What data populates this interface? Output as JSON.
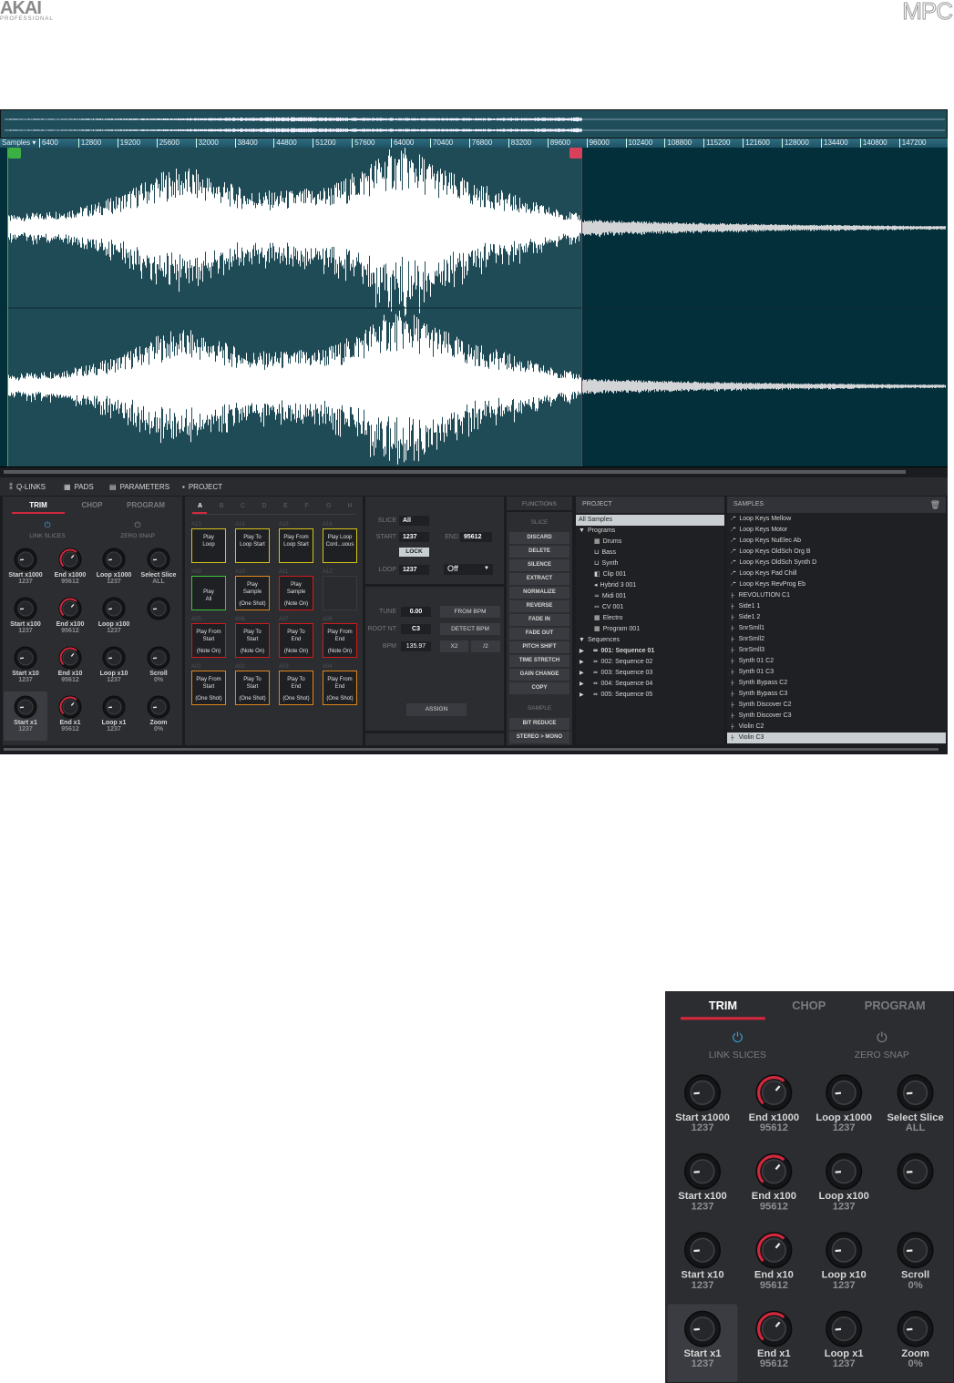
{
  "branding": {
    "akai": "AKAI",
    "akai_sub": "PROFESSIONAL",
    "mpc": "MPC"
  },
  "ruler": {
    "unit": "Samples",
    "ticks": [
      "6400",
      "12800",
      "19200",
      "25600",
      "32000",
      "38400",
      "44800",
      "51200",
      "57600",
      "64000",
      "70400",
      "76800",
      "83200",
      "89600",
      "96000",
      "102400",
      "108800",
      "115200",
      "121600",
      "128000",
      "134400",
      "140800",
      "147200"
    ]
  },
  "top_tabs": [
    {
      "label": "Q-LINKS",
      "icon": "q-links-icon"
    },
    {
      "label": "PADS",
      "icon": "pads-grid-icon"
    },
    {
      "label": "PARAMETERS",
      "icon": "parameters-icon"
    },
    {
      "label": "PROJECT",
      "icon": "project-file-icon"
    }
  ],
  "trim": {
    "tabs": [
      "TRIM",
      "CHOP",
      "PROGRAM"
    ],
    "active_tab": "TRIM",
    "toggles": [
      {
        "label": "LINK SLICES",
        "on": true
      },
      {
        "label": "ZERO SNAP",
        "on": false
      }
    ],
    "knobs": [
      {
        "label": "Start x1000",
        "value": "1237",
        "level": 0.02
      },
      {
        "label": "End x1000",
        "value": "95612",
        "level": 0.65
      },
      {
        "label": "Loop x1000",
        "value": "1237",
        "level": 0.02
      },
      {
        "label": "Select Slice",
        "value": "ALL",
        "level": 0.0
      },
      {
        "label": "Start x100",
        "value": "1237",
        "level": 0.02
      },
      {
        "label": "End x100",
        "value": "95612",
        "level": 0.65
      },
      {
        "label": "Loop x100",
        "value": "1237",
        "level": 0.02
      },
      {
        "label": "",
        "value": "",
        "level": 0.0
      },
      {
        "label": "Start x10",
        "value": "1237",
        "level": 0.02
      },
      {
        "label": "End x10",
        "value": "95612",
        "level": 0.65
      },
      {
        "label": "Loop x10",
        "value": "1237",
        "level": 0.02
      },
      {
        "label": "Scroll",
        "value": "0%",
        "level": 0.0
      },
      {
        "label": "Start x1",
        "value": "1237",
        "level": 0.02
      },
      {
        "label": "End x1",
        "value": "95612",
        "level": 0.65
      },
      {
        "label": "Loop x1",
        "value": "1237",
        "level": 0.02
      },
      {
        "label": "Zoom",
        "value": "0%",
        "level": 0.0
      }
    ]
  },
  "pads": {
    "banks": [
      "A",
      "B",
      "C",
      "D",
      "E",
      "F",
      "G",
      "H"
    ],
    "active_bank": "A",
    "grid": [
      {
        "id": "A13",
        "text": "Play\nLoop",
        "sub": "",
        "color": "#d6c419"
      },
      {
        "id": "A14",
        "text": "Play To\nLoop Start",
        "sub": "",
        "color": "#d6c419"
      },
      {
        "id": "A15",
        "text": "Play From\nLoop Start",
        "sub": "",
        "color": "#d6c419"
      },
      {
        "id": "A16",
        "text": "Play Loop\nCont...uous",
        "sub": "",
        "color": "#d6c419"
      },
      {
        "id": "A09",
        "text": "\nPlay\nAll",
        "sub": "",
        "color": "#3fc43f"
      },
      {
        "id": "A10",
        "text": "Play\nSample",
        "sub": "(One Shot)",
        "color": "#e0861a"
      },
      {
        "id": "A11",
        "text": "Play\nSample",
        "sub": "(Note On)",
        "color": "#d11a1a"
      },
      {
        "id": "A12",
        "text": "",
        "sub": "",
        "color": "#3a3a3c"
      },
      {
        "id": "A05",
        "text": "Play From\nStart",
        "sub": "(Note On)",
        "color": "#d11a1a"
      },
      {
        "id": "A06",
        "text": "Play To\nStart",
        "sub": "(Note On)",
        "color": "#d11a1a"
      },
      {
        "id": "A07",
        "text": "Play To\nEnd",
        "sub": "(Note On)",
        "color": "#d11a1a"
      },
      {
        "id": "A08",
        "text": "Play From\nEnd",
        "sub": "(Note On)",
        "color": "#d11a1a"
      },
      {
        "id": "A01",
        "text": "Play From\nStart",
        "sub": "(One Shot)",
        "color": "#e0861a"
      },
      {
        "id": "A02",
        "text": "Play To\nStart",
        "sub": "(One Shot)",
        "color": "#e0861a"
      },
      {
        "id": "A03",
        "text": "Play To\nEnd",
        "sub": "(One Shot)",
        "color": "#e0861a"
      },
      {
        "id": "A04",
        "text": "Play From\nEnd",
        "sub": "(One Shot)",
        "color": "#e0861a"
      }
    ]
  },
  "slice": {
    "slice_label": "SLICE",
    "slice_value": "All",
    "start_label": "START",
    "start_value": "1237",
    "end_label": "END",
    "end_value": "95612",
    "lock_label": "LOCK",
    "loop_label": "LOOP",
    "loop_value": "1237",
    "loop_mode": "Off",
    "tune_label": "TUNE",
    "tune_value": "0.00",
    "root_label": "ROOT NT",
    "root_value": "C3",
    "bpm_label": "BPM",
    "bpm_value": "135.97",
    "from_bpm": "FROM BPM",
    "detect_bpm": "DETECT BPM",
    "x2": "X2",
    "half": "/2",
    "assign": "ASSIGN"
  },
  "functions": {
    "title": "FUNCTIONS",
    "slice_header": "SLICE",
    "slice_items": [
      "DISCARD",
      "DELETE",
      "SILENCE",
      "EXTRACT",
      "NORMALIZE",
      "REVERSE",
      "FADE IN",
      "FADE OUT",
      "PITCH SHIFT",
      "TIME STRETCH",
      "GAIN CHANGE",
      "COPY"
    ],
    "sample_header": "SAMPLE",
    "sample_items": [
      "BIT REDUCE",
      "STEREO > MONO"
    ]
  },
  "project": {
    "title": "PROJECT",
    "items": [
      {
        "label": "All Samples",
        "indent": 0,
        "icon": "",
        "selected": true
      },
      {
        "label": "Programs",
        "indent": 0,
        "icon": "▼"
      },
      {
        "label": "Drums",
        "indent": 2,
        "icon": "▦"
      },
      {
        "label": "Bass",
        "indent": 2,
        "icon": "⊔"
      },
      {
        "label": "Synth",
        "indent": 2,
        "icon": "⊔"
      },
      {
        "label": "Clip 001",
        "indent": 2,
        "icon": "◧"
      },
      {
        "label": "Hybrid 3 001",
        "indent": 2,
        "icon": "◂"
      },
      {
        "label": "Midi 001",
        "indent": 2,
        "icon": "≂"
      },
      {
        "label": "CV 001",
        "indent": 2,
        "icon": "∾"
      },
      {
        "label": "Electro",
        "indent": 2,
        "icon": "▦"
      },
      {
        "label": "Program 001",
        "indent": 2,
        "icon": "▦"
      },
      {
        "label": "Sequences",
        "indent": 0,
        "icon": "▼"
      },
      {
        "label": "001: Sequence 01",
        "indent": 1,
        "icon": "≖",
        "bold": true
      },
      {
        "label": "002: Sequence 02",
        "indent": 1,
        "icon": "≖"
      },
      {
        "label": "003: Sequence 03",
        "indent": 1,
        "icon": "≖"
      },
      {
        "label": "004: Sequence 04",
        "indent": 1,
        "icon": "≖"
      },
      {
        "label": "005: Sequence 05",
        "indent": 1,
        "icon": "≖"
      }
    ]
  },
  "samples": {
    "title": "SAMPLES",
    "items": [
      {
        "label": "Loop Keys Mellow",
        "type": "loop"
      },
      {
        "label": "Loop Keys Motor",
        "type": "loop"
      },
      {
        "label": "Loop Keys NuElec Ab",
        "type": "loop"
      },
      {
        "label": "Loop Keys OldSch Org B",
        "type": "loop"
      },
      {
        "label": "Loop Keys OldSch Synth D",
        "type": "loop"
      },
      {
        "label": "Loop Keys Pad Chill",
        "type": "loop"
      },
      {
        "label": "Loop Keys RevProg Eb",
        "type": "loop"
      },
      {
        "label": "REVOLUTION C1",
        "type": "oneshot"
      },
      {
        "label": "Side1 1",
        "type": "oneshot"
      },
      {
        "label": "Side1 2",
        "type": "oneshot"
      },
      {
        "label": "SnrSmll1",
        "type": "oneshot"
      },
      {
        "label": "SnrSmll2",
        "type": "oneshot"
      },
      {
        "label": "SnrSmll3",
        "type": "oneshot"
      },
      {
        "label": "Synth 01 C2",
        "type": "oneshot"
      },
      {
        "label": "Synth 01 C3",
        "type": "oneshot"
      },
      {
        "label": "Synth Bypass C2",
        "type": "oneshot"
      },
      {
        "label": "Synth Bypass C3",
        "type": "oneshot"
      },
      {
        "label": "Synth Discover C2",
        "type": "oneshot"
      },
      {
        "label": "Synth Discover C3",
        "type": "oneshot"
      },
      {
        "label": "Violin C2",
        "type": "oneshot"
      },
      {
        "label": "Violin C3",
        "type": "oneshot",
        "selected": true
      }
    ]
  },
  "colors": {
    "accent": "#d0283c",
    "link_on": "#3aa6e0",
    "wave_selected": "#1f4b57",
    "wave_bg": "#032f3a",
    "start_marker": "#3cb043",
    "end_marker": "#d9415a"
  }
}
